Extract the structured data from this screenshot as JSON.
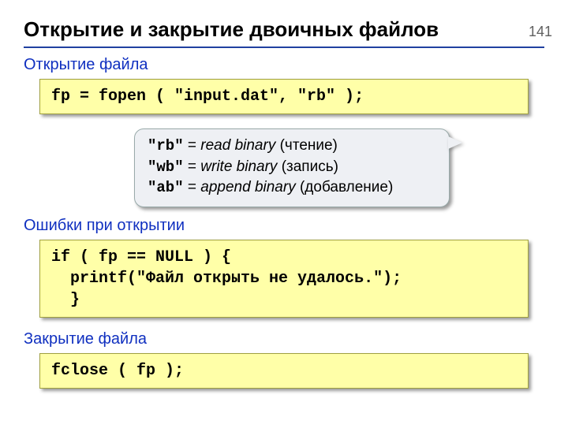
{
  "page_number": "141",
  "title": "Открытие и закрытие двоичных файлов",
  "sections": {
    "open": {
      "label": "Открытие файла",
      "code": "fp = fopen ( \"input.dat\", \"rb\" );"
    },
    "modes": {
      "rb": {
        "key": "\"rb\"",
        "eq": " = ",
        "eng": "read binary",
        "ru": " (чтение)"
      },
      "wb": {
        "key": "\"wb\"",
        "eq": " = ",
        "eng": "write binary",
        "ru": " (запись)"
      },
      "ab": {
        "key": "\"ab\"",
        "eq": " = ",
        "eng": "append binary",
        "ru": " (добавление)"
      }
    },
    "errors": {
      "label": "Ошибки при открытии",
      "code": "if ( fp == NULL ) {\n  printf(\"Файл открыть не удалось.\");\n  }"
    },
    "close": {
      "label": "Закрытие файла",
      "code": "fclose ( fp );"
    }
  }
}
